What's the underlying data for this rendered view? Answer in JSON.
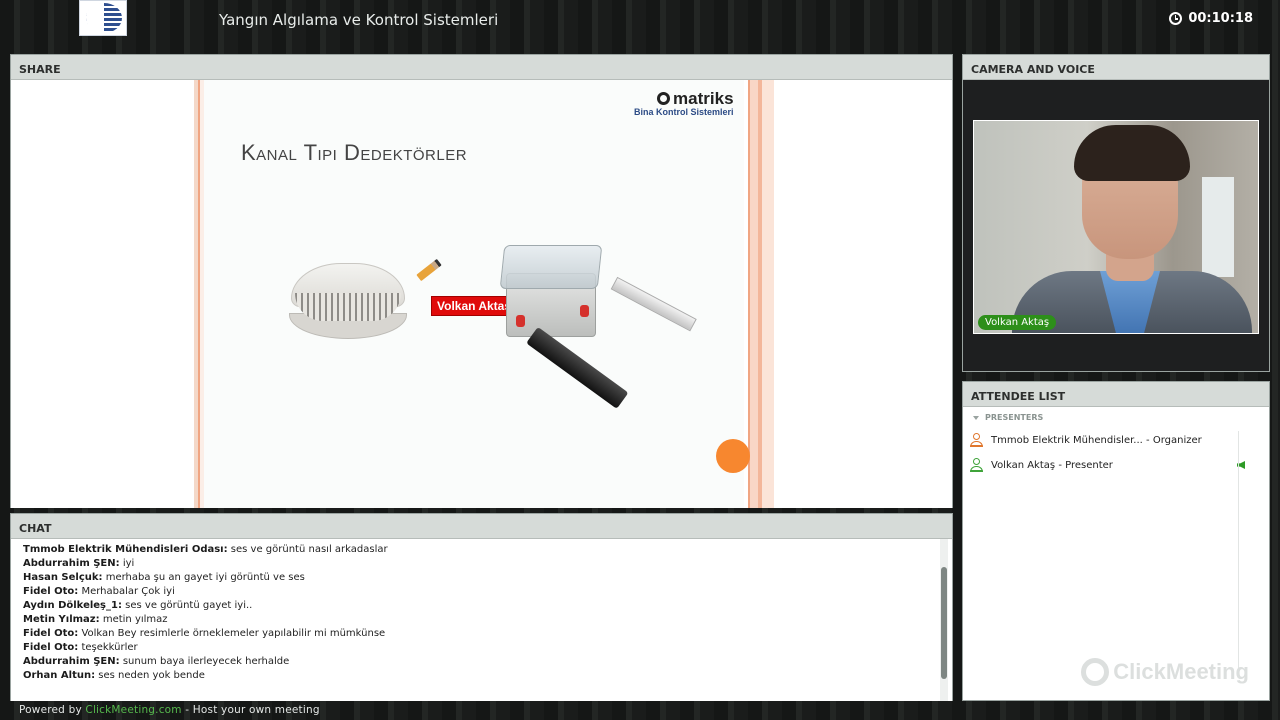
{
  "header": {
    "title": "Yangın Algılama ve Kontrol Sistemleri",
    "timer": "00:10:18"
  },
  "share": {
    "label": "SHARE",
    "slide": {
      "brand": "matriks",
      "brand_subtitle": "Bina Kontrol Sistemleri",
      "title": "Kanal Tipi Dedektörler",
      "cursor_tag": "Volkan Aktaş"
    }
  },
  "chat": {
    "label": "CHAT",
    "messages": [
      {
        "author": "Tmmob Elektrik Mühendisleri Odası:",
        "text": "ses ve görüntü nasıl arkadaslar"
      },
      {
        "author": "Abdurrahim ŞEN:",
        "text": "iyi"
      },
      {
        "author": "Hasan Selçuk:",
        "text": "merhaba şu an gayet iyi görüntü ve ses"
      },
      {
        "author": "Fidel Oto:",
        "text": "Merhabalar Çok iyi"
      },
      {
        "author": "Aydın Dölkeleş_1:",
        "text": "ses ve görüntü gayet iyi.."
      },
      {
        "author": "Metin Yılmaz:",
        "text": "metin yılmaz"
      },
      {
        "author": "Fidel Oto:",
        "text": "Volkan Bey resimlerle örneklemeler yapılabilir mi mümkünse"
      },
      {
        "author": "Fidel Oto:",
        "text": "teşekkürler"
      },
      {
        "author": "Abdurrahim ŞEN:",
        "text": "sunum baya ilerleyecek herhalde"
      },
      {
        "author": "Orhan Altun:",
        "text": "ses neden yok bende"
      }
    ]
  },
  "camera": {
    "label": "CAMERA AND VOICE",
    "speaker_name": "Volkan Aktaş"
  },
  "attendees": {
    "label": "ATTENDEE LIST",
    "section": "PRESENTERS",
    "people": [
      {
        "name": "Tmmob Elektrik Mühendisler...",
        "role": "- Organizer",
        "color": "#e0762d"
      },
      {
        "name": "Volkan Aktaş",
        "role": "- Presenter",
        "color": "#3fa33a"
      }
    ],
    "watermark": "ClickMeeting"
  },
  "footer": {
    "prefix": "Powered by",
    "link": "ClickMeeting.com",
    "suffix": "- Host your own meeting"
  }
}
